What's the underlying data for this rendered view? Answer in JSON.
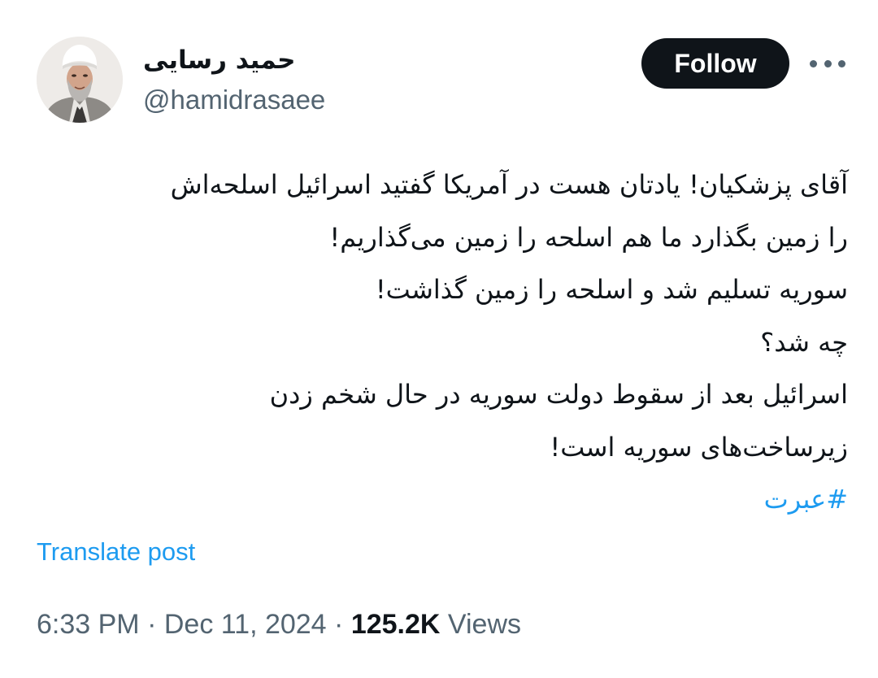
{
  "author": {
    "display_name": "حمید رسایی",
    "handle": "@hamidrasaee",
    "avatar_icon": "profile-photo"
  },
  "actions": {
    "follow_label": "Follow",
    "more_icon": "more-dots-icon"
  },
  "tweet": {
    "lines": [
      "آقای پزشکیان! یادتان هست در آمریکا گفتید اسرائیل اسلحه‌اش",
      "را زمین بگذارد ما هم اسلحه را زمین می‌گذاریم!",
      "سوریه تسلیم شد و اسلحه را زمین گذاشت!",
      "چه شد؟",
      "اسرائیل بعد از سقوط دولت سوریه در حال شخم زدن",
      "زیرساخت‌های سوریه است!"
    ],
    "hashtag": "#عبرت",
    "translate_label": "Translate post"
  },
  "meta": {
    "time": "6:33 PM",
    "separator": "·",
    "date": "Dec 11, 2024",
    "views_count": "125.2K",
    "views_label": "Views"
  },
  "colors": {
    "accent": "#1d9bf0",
    "text_primary": "#0f1419",
    "text_secondary": "#536471",
    "button_bg": "#0f1419"
  }
}
